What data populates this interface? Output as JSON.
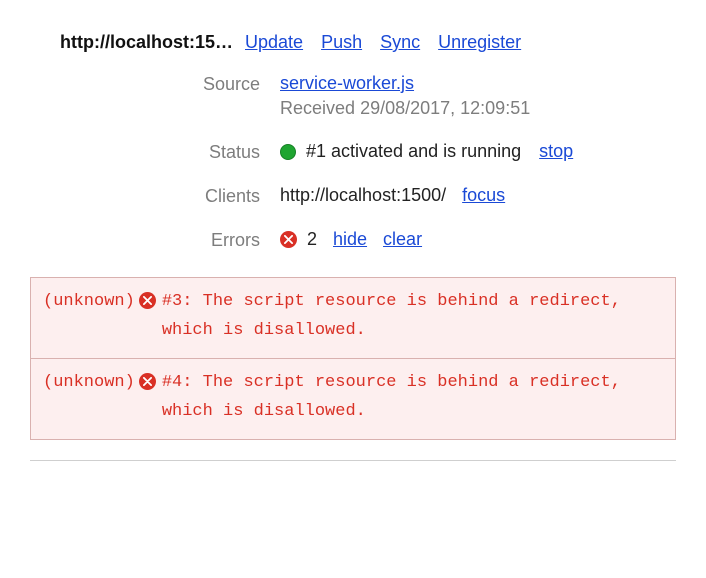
{
  "header": {
    "url": "http://localhost:15…",
    "actions": {
      "update": "Update",
      "push": "Push",
      "sync": "Sync",
      "unregister": "Unregister"
    }
  },
  "labels": {
    "source": "Source",
    "status": "Status",
    "clients": "Clients",
    "errors": "Errors"
  },
  "source": {
    "filename": "service-worker.js",
    "received_label": "Received",
    "received_at": "29/08/2017, 12:09:51"
  },
  "status": {
    "text": "#1 activated and is running",
    "stop": "stop",
    "color": "#1fa531"
  },
  "clients": {
    "url": "http://localhost:1500/",
    "focus": "focus"
  },
  "errors": {
    "count": "2",
    "hide": "hide",
    "clear": "clear",
    "items": [
      {
        "source": "(unknown)",
        "message": "#3: The script resource is behind a redirect, which is disallowed."
      },
      {
        "source": "(unknown)",
        "message": "#4: The script resource is behind a redirect, which is disallowed."
      }
    ]
  }
}
